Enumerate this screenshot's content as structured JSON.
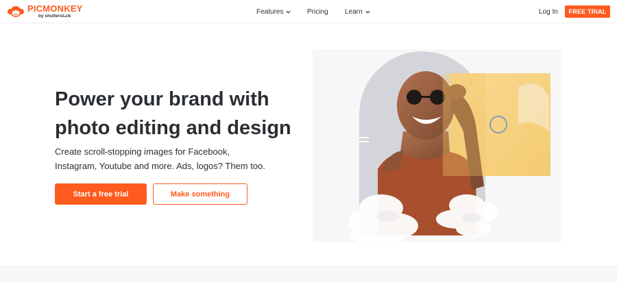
{
  "brand": {
    "name": "PICMONKEY",
    "tagline": "by shutterstₙck",
    "accent_color": "#ff5b1f"
  },
  "nav": {
    "items": [
      {
        "label": "Features",
        "has_dropdown": true
      },
      {
        "label": "Pricing",
        "has_dropdown": false
      },
      {
        "label": "Learn",
        "has_dropdown": true
      }
    ],
    "login_label": "Log In",
    "free_trial_label": "FREE TRIAL"
  },
  "hero": {
    "headline_line1": "Power your brand with",
    "headline_line2": "photo editing and design",
    "subtext_line1": "Create scroll-stopping images for Facebook,",
    "subtext_line2": "Instagram, Youtube and more. Ads, logos? Them too.",
    "primary_button": "Start a free trial",
    "secondary_button": "Make something"
  },
  "icons": {
    "logo": "monkey-logo-icon",
    "dropdown": "chevron-down-icon"
  }
}
